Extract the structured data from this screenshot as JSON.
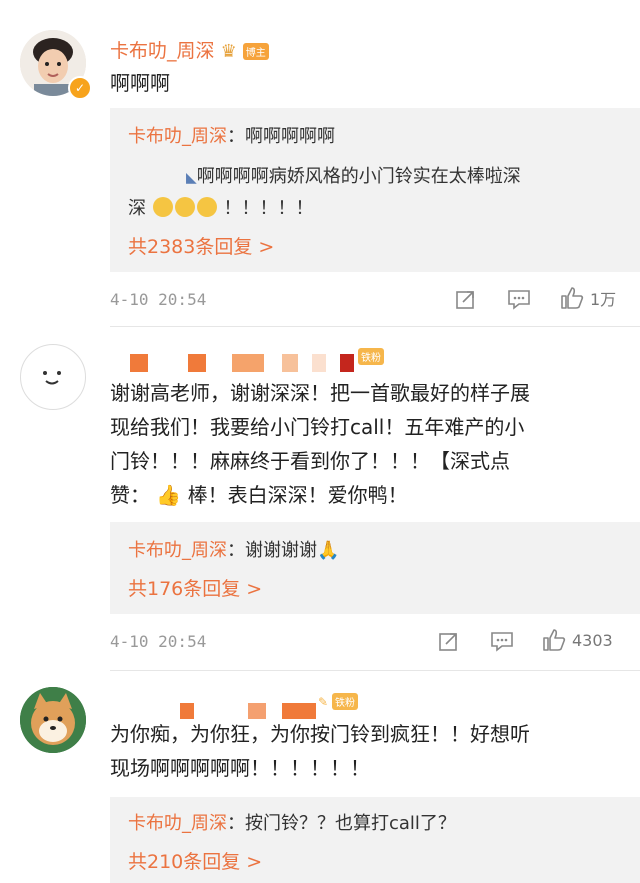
{
  "colors": {
    "accent": "#eb7340",
    "muted": "#999999",
    "reply_bg": "#f2f2f2",
    "badge": "#f6b64b"
  },
  "comments": [
    {
      "username": "卡布叻_周深",
      "owner_badge": "博主",
      "text": "啊啊啊",
      "reply_main": {
        "author": "卡布叻_周深",
        "text": "：啊啊啊啊啊"
      },
      "reply_quote": "啊啊啊啊病娇风格的小门铃实在太棒啦深",
      "reply_quote2_prefix": "深",
      "reply_quote2_suffix": "！！！！！",
      "reply_count": "共2383条回复 >",
      "time": "4-10 20:54",
      "likes": "1万",
      "icons": [
        "share-icon",
        "comment-icon",
        "like-icon"
      ]
    },
    {
      "fan_badge": "铁粉",
      "text_lines": [
        "谢谢高老师，谢谢深深！把一首歌最好的样子展",
        "现给我们！我要给小门铃打call！五年难产的小",
        "门铃！！！麻麻终于看到你了！！！【深式点"
      ],
      "text_last_prefix": "赞：",
      "text_last_suffix": "棒！表白深深！爱你鸭！",
      "reply_main": {
        "author": "卡布叻_周深",
        "text": "：谢谢谢谢"
      },
      "reply_count": "共176条回复 >",
      "time": "4-10 20:54",
      "likes": "4303"
    },
    {
      "fan_badge": "铁粉",
      "text_lines": [
        "为你痴，为你狂，为你按门铃到疯狂！！好想听",
        "现场啊啊啊啊啊！！！！！！"
      ],
      "reply_main": {
        "author": "卡布叻_周深",
        "text": "：按门铃？？也算打call了？"
      },
      "reply_count": "共210条回复 >"
    }
  ]
}
